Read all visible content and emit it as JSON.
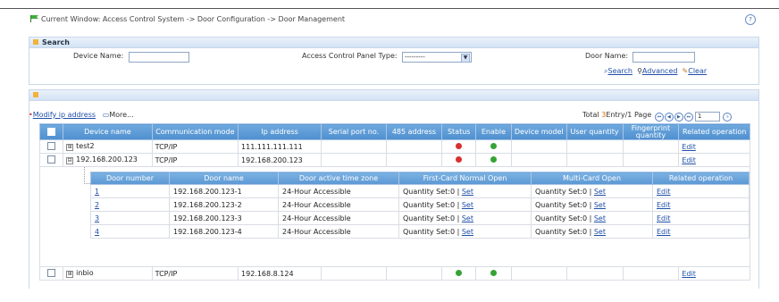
{
  "breadcrumb": "Current Window: Access Control System -> Door Configuration -> Door Management",
  "search": {
    "title": "Search",
    "device_name_label": "Device Name:",
    "device_name_value": "",
    "panel_type_label": "Access Control Panel Type:",
    "panel_type_value": "---------",
    "door_name_label": "Door Name:",
    "door_name_value": "",
    "search_label": "Search",
    "advanced_label": "Advanced",
    "clear_label": "Clear"
  },
  "toolbar": {
    "modify_ip": "Modify ip address",
    "more": "More...",
    "total_prefix": "Total",
    "total_count": "3",
    "total_mid": "Entry/1 Page",
    "page_value": "1"
  },
  "columns": [
    "Device name",
    "Communication mode",
    "Ip address",
    "Serial port no.",
    "485 address",
    "Status",
    "Enable",
    "Device model",
    "User quantity",
    "Fingerprint quantity",
    "Related operation"
  ],
  "devices": [
    {
      "expander": "⊞",
      "name": "test2",
      "comm": "TCP/IP",
      "ip": "111.111.111.111",
      "serial": "",
      "addr485": "",
      "status": "red",
      "enable": "green",
      "model": "",
      "users": "",
      "fingerprints": "",
      "op": "Edit"
    },
    {
      "expander": "⊟",
      "name": "192.168.200.123",
      "comm": "TCP/IP",
      "ip": "192.168.200.123",
      "serial": "",
      "addr485": "",
      "status": "red",
      "enable": "green",
      "model": "",
      "users": "",
      "fingerprints": "",
      "op": "Edit"
    },
    {
      "expander": "⊞",
      "name": "inbio",
      "comm": "TCP/IP",
      "ip": "192.168.8.124",
      "serial": "",
      "addr485": "",
      "status": "green",
      "enable": "green",
      "model": "",
      "users": "",
      "fingerprints": "",
      "op": "Edit"
    }
  ],
  "doors_columns": [
    "Door number",
    "Door name",
    "Door active time zone",
    "First-Card Normal Open",
    "Multi-Card Open",
    "Related operation"
  ],
  "doors": [
    {
      "num": "1",
      "name": "192.168.200.123-1",
      "zone": "24-Hour Accessible",
      "first_card": "Quantity Set:0 | ",
      "multi_card": "Quantity Set:0 | ",
      "set": "Set",
      "op": "Edit"
    },
    {
      "num": "2",
      "name": "192.168.200.123-2",
      "zone": "24-Hour Accessible",
      "first_card": "Quantity Set:0 | ",
      "multi_card": "Quantity Set:0 | ",
      "set": "Set",
      "op": "Edit"
    },
    {
      "num": "3",
      "name": "192.168.200.123-3",
      "zone": "24-Hour Accessible",
      "first_card": "Quantity Set:0 | ",
      "multi_card": "Quantity Set:0 | ",
      "set": "Set",
      "op": "Edit"
    },
    {
      "num": "4",
      "name": "192.168.200.123-4",
      "zone": "24-Hour Accessible",
      "first_card": "Quantity Set:0 | ",
      "multi_card": "Quantity Set:0 | ",
      "set": "Set",
      "op": "Edit"
    }
  ]
}
